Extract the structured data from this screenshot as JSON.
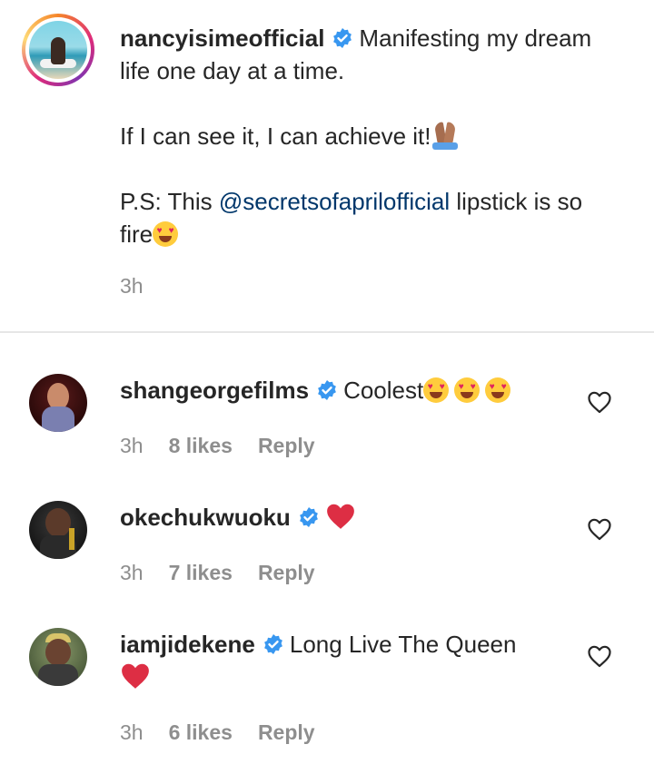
{
  "post": {
    "username": "nancyisimeofficial",
    "caption_line1": "Manifesting my dream life one day at a time.",
    "caption_line2": "If I can see it, I can achieve it!",
    "caption_ps_prefix": "P.S: This ",
    "caption_mention": "@secretsofaprilofficial",
    "caption_ps_suffix": " lipstick is so fire",
    "time": "3h",
    "avatar_icon": "profile-photo-meditation",
    "emojis": [
      "folded-hands-emoji",
      "heart-eyes-emoji"
    ]
  },
  "comments": [
    {
      "username": "shangeorgefilms",
      "text": "Coolest",
      "emoji": "heart-eyes-emoji x3",
      "time": "3h",
      "likes": "8 likes",
      "reply": "Reply"
    },
    {
      "username": "okechukwuoku",
      "text": "",
      "emoji": "red-heart-emoji",
      "time": "3h",
      "likes": "7 likes",
      "reply": "Reply"
    },
    {
      "username": "iamjidekene",
      "text": "Long Live The Queen",
      "emoji": "red-heart-emoji",
      "time": "3h",
      "likes": "6 likes",
      "reply": "Reply"
    }
  ],
  "colors": {
    "verified": "#3897f0",
    "mention": "#00376b",
    "muted": "#8e8e8e",
    "heart": "#e0245e"
  }
}
